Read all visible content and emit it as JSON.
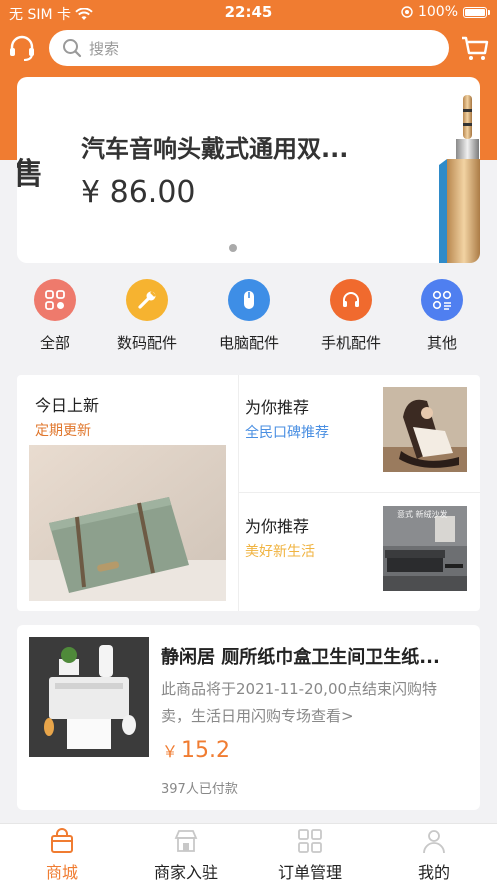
{
  "status_bar": {
    "carrier": "无 SIM 卡",
    "time": "22:45",
    "battery": "100%"
  },
  "search": {
    "placeholder": "搜索"
  },
  "banner": {
    "prev_text": "售",
    "title": "汽车音响头戴式通用双...",
    "price": "¥ 86.00"
  },
  "categories": [
    {
      "label": "全部",
      "color": "#ee7a6c",
      "icon": "grid-icon"
    },
    {
      "label": "数码配件",
      "color": "#f6b330",
      "icon": "wrench-icon"
    },
    {
      "label": "电脑配件",
      "color": "#3e8ee6",
      "icon": "mouse-icon"
    },
    {
      "label": "手机配件",
      "color": "#f06a2e",
      "icon": "headset-icon"
    },
    {
      "label": "其他",
      "color": "#4f7ff0",
      "icon": "apps-icon"
    }
  ],
  "feature": {
    "left_title": "今日上新",
    "left_sub": "定期更新",
    "rec1_title": "为你推荐",
    "rec1_sub": "全民口碑推荐",
    "rec1_sub_color": "#4a8fe2",
    "rec2_title": "为你推荐",
    "rec2_sub": "美好新生活",
    "rec2_sub_color": "#f0b340",
    "rec2_img_text": "意式 新绒沙发"
  },
  "product": {
    "name": "静闲居 厕所纸巾盒卫生间卫生纸...",
    "desc": "此商品将于2021-11-20,00点结束闪购特卖，生活日用闪购专场查看>",
    "price_symbol": "￥",
    "price": "15.2",
    "paid": "397人已付款"
  },
  "tabs": [
    {
      "label": "商城",
      "active": true
    },
    {
      "label": "商家入驻",
      "active": false
    },
    {
      "label": "订单管理",
      "active": false
    },
    {
      "label": "我的",
      "active": false
    }
  ],
  "accent": "#f07c31"
}
